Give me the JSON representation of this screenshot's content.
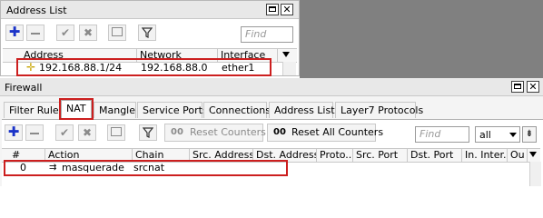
{
  "address_list": {
    "title": "Address List",
    "find_placeholder": "Find",
    "columns": [
      "Address",
      "Network",
      "Interface"
    ],
    "row": {
      "address": "192.168.88.1/24",
      "network": "192.168.88.0",
      "interface": "ether1"
    }
  },
  "firewall": {
    "title": "Firewall",
    "tabs": [
      "Filter Rules",
      "NAT",
      "Mangle",
      "Service Ports",
      "Connections",
      "Address Lists",
      "Layer7 Protocols"
    ],
    "active_tab": "NAT",
    "buttons": {
      "reset_counters": "Reset Counters",
      "reset_all_counters": "Reset All Counters",
      "counter_prefix": "00"
    },
    "find_placeholder": "Find",
    "filter_value": "all",
    "columns": [
      "#",
      "Action",
      "Chain",
      "Src. Address",
      "Dst. Address",
      "Proto...",
      "Src. Port",
      "Dst. Port",
      "In. Inter...",
      "Ou"
    ],
    "row": {
      "num": "0",
      "action": "masquerade",
      "chain": "srcnat"
    }
  },
  "colors": {
    "accent_blue": "#1a33c8",
    "highlight_red": "#cc1f1f",
    "titlebar": "#e8e8e8"
  }
}
